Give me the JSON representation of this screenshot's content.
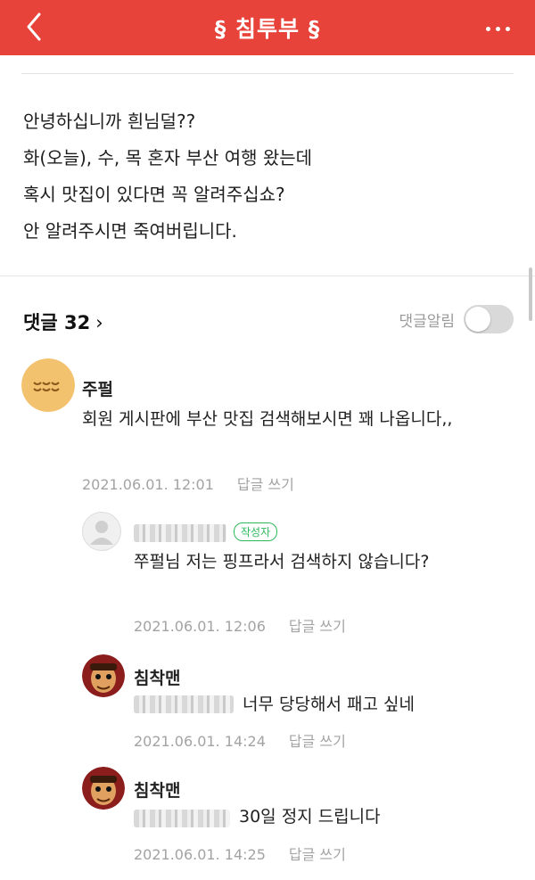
{
  "appbar": {
    "title": "§ 침투부 §",
    "back_icon": "chevron-left-icon",
    "more_icon": "more-horizontal-icon",
    "color": "#e8433a"
  },
  "post": {
    "lines": [
      "안녕하십니까 흰님덜??",
      "화(오늘), 수, 목 혼자 부산 여행 왔는데",
      "혹시 맛집이 있다면 꼭 알려주십쇼?",
      "안 알려주시면 죽여버립니다."
    ]
  },
  "comments_header": {
    "label": "댓글 32",
    "chevron": "›",
    "notify_label": "댓글알림",
    "notify_on": false
  },
  "comments": [
    {
      "author": "주펄",
      "text": "회원 게시판에 부산 맛집 검색해보시면 꽤 나옵니다,,",
      "date": "2021.06.01. 12:01",
      "reply_label": "답글 쓰기",
      "avatar_color": "#f3c26f"
    },
    {
      "badge": "작성자",
      "text": "쭈펄님 저는 핑프라서 검색하지 않습니다?",
      "date": "2021.06.01. 12:06",
      "reply_label": "답글 쓰기",
      "badge_color": "#2eb85c"
    },
    {
      "author": "침착맨",
      "text": "너무 당당해서 패고 싶네",
      "date": "2021.06.01. 14:24",
      "reply_label": "답글 쓰기"
    },
    {
      "author": "침착맨",
      "text": "30일 정지 드립니다",
      "date": "2021.06.01. 14:25",
      "reply_label": "답글 쓰기"
    }
  ]
}
